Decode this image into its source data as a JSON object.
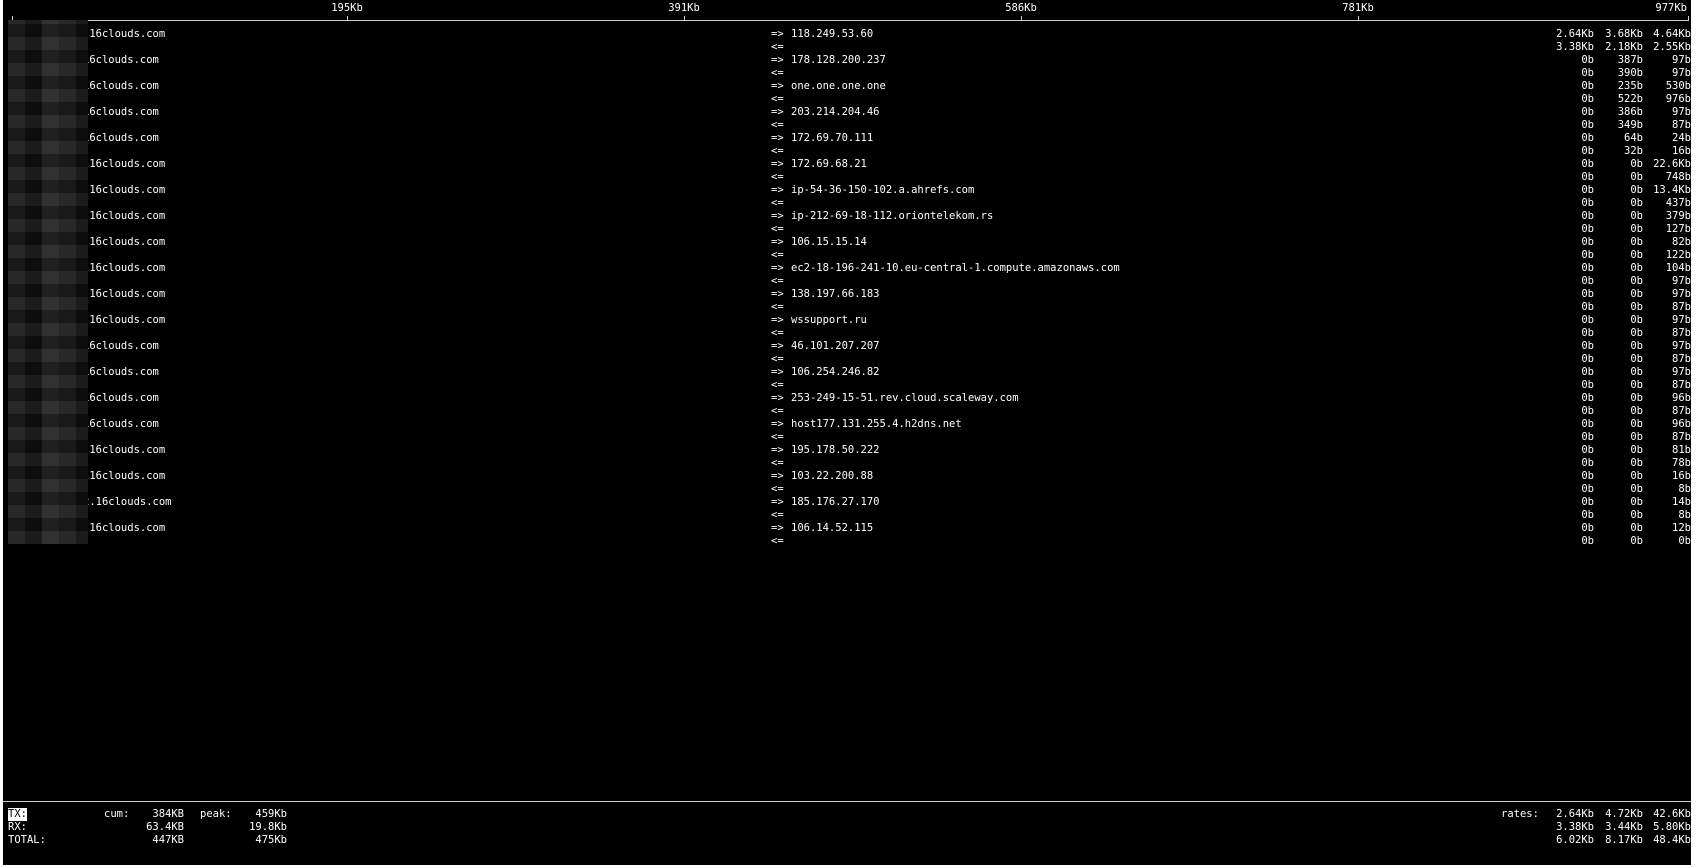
{
  "scale": {
    "ticks": [
      "195Kb",
      "391Kb",
      "586Kb",
      "781Kb",
      "977Kb"
    ]
  },
  "hosts": [
    {
      "local": ".16clouds.com",
      "remote": "118.249.53.60",
      "sent": [
        "2.64Kb",
        "3.68Kb",
        "4.64Kb"
      ],
      "recv": [
        "3.38Kb",
        "2.18Kb",
        "2.55Kb"
      ]
    },
    {
      "local": "16clouds.com",
      "remote": "178.128.200.237",
      "sent": [
        "0b",
        "387b",
        "97b"
      ],
      "recv": [
        "0b",
        "390b",
        "97b"
      ]
    },
    {
      "local": "16clouds.com",
      "remote": "one.one.one.one",
      "sent": [
        "0b",
        "235b",
        "530b"
      ],
      "recv": [
        "0b",
        "522b",
        "976b"
      ]
    },
    {
      "local": "16clouds.com",
      "remote": "203.214.204.46",
      "sent": [
        "0b",
        "386b",
        "97b"
      ],
      "recv": [
        "0b",
        "349b",
        "87b"
      ]
    },
    {
      "local": "16clouds.com",
      "remote": "172.69.70.111",
      "sent": [
        "0b",
        "64b",
        "24b"
      ],
      "recv": [
        "0b",
        "32b",
        "16b"
      ]
    },
    {
      "local": ".16clouds.com",
      "remote": "172.69.68.21",
      "sent": [
        "0b",
        "0b",
        "22.6Kb"
      ],
      "recv": [
        "0b",
        "0b",
        "748b"
      ]
    },
    {
      "local": ".16clouds.com",
      "remote": "ip-54-36-150-102.a.ahrefs.com",
      "sent": [
        "0b",
        "0b",
        "13.4Kb"
      ],
      "recv": [
        "0b",
        "0b",
        "437b"
      ]
    },
    {
      "local": ".16clouds.com",
      "remote": "ip-212-69-18-112.oriontelekom.rs",
      "sent": [
        "0b",
        "0b",
        "379b"
      ],
      "recv": [
        "0b",
        "0b",
        "127b"
      ]
    },
    {
      "local": ".16clouds.com",
      "remote": "106.15.15.14",
      "sent": [
        "0b",
        "0b",
        "82b"
      ],
      "recv": [
        "0b",
        "0b",
        "122b"
      ]
    },
    {
      "local": ".16clouds.com",
      "remote": "ec2-18-196-241-10.eu-central-1.compute.amazonaws.com",
      "sent": [
        "0b",
        "0b",
        "104b"
      ],
      "recv": [
        "0b",
        "0b",
        "97b"
      ]
    },
    {
      "local": ".16clouds.com",
      "remote": "138.197.66.183",
      "sent": [
        "0b",
        "0b",
        "97b"
      ],
      "recv": [
        "0b",
        "0b",
        "87b"
      ]
    },
    {
      "local": ".16clouds.com",
      "remote": "wssupport.ru",
      "sent": [
        "0b",
        "0b",
        "97b"
      ],
      "recv": [
        "0b",
        "0b",
        "87b"
      ]
    },
    {
      "local": "16clouds.com",
      "remote": "46.101.207.207",
      "sent": [
        "0b",
        "0b",
        "97b"
      ],
      "recv": [
        "0b",
        "0b",
        "87b"
      ]
    },
    {
      "local": "16clouds.com",
      "remote": "106.254.246.82",
      "sent": [
        "0b",
        "0b",
        "97b"
      ],
      "recv": [
        "0b",
        "0b",
        "87b"
      ]
    },
    {
      "local": "16clouds.com",
      "remote": "253-249-15-51.rev.cloud.scaleway.com",
      "sent": [
        "0b",
        "0b",
        "96b"
      ],
      "recv": [
        "0b",
        "0b",
        "87b"
      ]
    },
    {
      "local": "16clouds.com",
      "remote": "host177.131.255.4.h2dns.net",
      "sent": [
        "0b",
        "0b",
        "96b"
      ],
      "recv": [
        "0b",
        "0b",
        "87b"
      ]
    },
    {
      "local": ".16clouds.com",
      "remote": "195.178.50.222",
      "sent": [
        "0b",
        "0b",
        "81b"
      ],
      "recv": [
        "0b",
        "0b",
        "78b"
      ]
    },
    {
      "local": ".16clouds.com",
      "remote": "103.22.200.88",
      "sent": [
        "0b",
        "0b",
        "16b"
      ],
      "recv": [
        "0b",
        "0b",
        "8b"
      ]
    },
    {
      "local": "2.16clouds.com",
      "remote": "185.176.27.170",
      "sent": [
        "0b",
        "0b",
        "14b"
      ],
      "recv": [
        "0b",
        "0b",
        "8b"
      ]
    },
    {
      "local": ".16clouds.com",
      "remote": "106.14.52.115",
      "sent": [
        "0b",
        "0b",
        "12b"
      ],
      "recv": [
        "0b",
        "0b",
        "0b"
      ]
    }
  ],
  "arrows": {
    "out": "=>",
    "in": "<="
  },
  "footer": {
    "labels": {
      "tx": "TX:",
      "rx": "RX:",
      "total": "TOTAL:",
      "cum": "cum:",
      "peak": "peak:",
      "rates": "rates:"
    },
    "cum": {
      "tx": "384KB",
      "rx": "63.4KB",
      "total": "447KB"
    },
    "peak": {
      "tx": "459Kb",
      "rx": "19.8Kb",
      "total": "475Kb"
    },
    "rates": {
      "tx": [
        "2.64Kb",
        "4.72Kb",
        "42.6Kb"
      ],
      "rx": [
        "3.38Kb",
        "3.44Kb",
        "5.80Kb"
      ],
      "total": [
        "6.02Kb",
        "8.17Kb",
        "48.4Kb"
      ]
    }
  }
}
